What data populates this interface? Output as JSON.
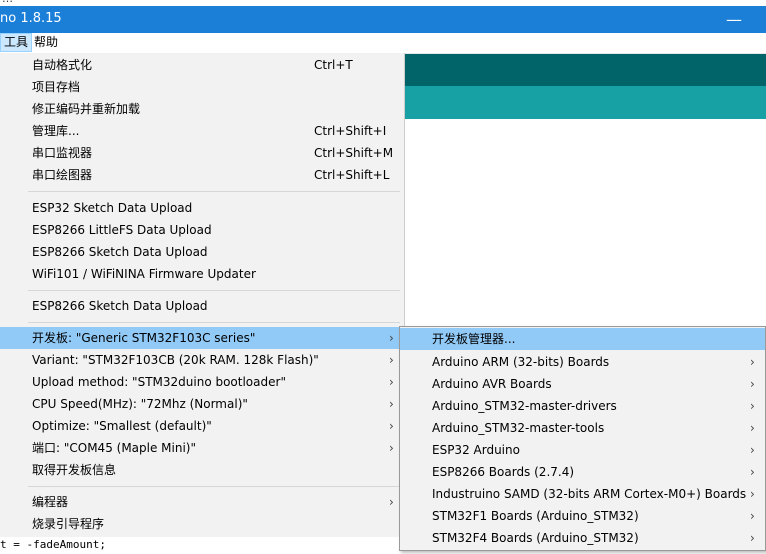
{
  "window": {
    "title": "no 1.8.15",
    "minimize_glyph": "—"
  },
  "top_strip_text": "…",
  "menubar": {
    "items": [
      {
        "label": "工具",
        "active": true
      },
      {
        "label": "帮助",
        "active": false
      }
    ]
  },
  "tools_menu": {
    "arrow_glyph": "›",
    "items": [
      {
        "label": "自动格式化",
        "shortcut": "Ctrl+T"
      },
      {
        "label": "项目存档",
        "shortcut": ""
      },
      {
        "label": "修正编码并重新加载",
        "shortcut": ""
      },
      {
        "label": "管理库...",
        "shortcut": "Ctrl+Shift+I"
      },
      {
        "label": "串口监视器",
        "shortcut": "Ctrl+Shift+M"
      },
      {
        "label": "串口绘图器",
        "shortcut": "Ctrl+Shift+L"
      },
      {
        "label": "ESP32 Sketch Data Upload",
        "shortcut": ""
      },
      {
        "label": "ESP8266 LittleFS Data Upload",
        "shortcut": ""
      },
      {
        "label": "ESP8266 Sketch Data Upload",
        "shortcut": ""
      },
      {
        "label": "WiFi101 / WiFiNINA Firmware Updater",
        "shortcut": ""
      },
      {
        "label": "ESP8266 Sketch Data Upload",
        "shortcut": ""
      },
      {
        "label": "开发板: \"Generic STM32F103C series\"",
        "shortcut": ""
      },
      {
        "label": "Variant: \"STM32F103CB (20k RAM. 128k Flash)\"",
        "shortcut": ""
      },
      {
        "label": "Upload method: \"STM32duino bootloader\"",
        "shortcut": ""
      },
      {
        "label": "CPU Speed(MHz): \"72Mhz (Normal)\"",
        "shortcut": ""
      },
      {
        "label": "Optimize: \"Smallest (default)\"",
        "shortcut": ""
      },
      {
        "label": "端口: \"COM45 (Maple Mini)\"",
        "shortcut": ""
      },
      {
        "label": "取得开发板信息",
        "shortcut": ""
      },
      {
        "label": "编程器",
        "shortcut": ""
      },
      {
        "label": "烧录引导程序",
        "shortcut": ""
      }
    ]
  },
  "board_submenu": {
    "items": [
      {
        "label": "开发板管理器..."
      },
      {
        "label": "Arduino ARM (32-bits) Boards"
      },
      {
        "label": "Arduino AVR Boards"
      },
      {
        "label": "Arduino_STM32-master-drivers"
      },
      {
        "label": "Arduino_STM32-master-tools"
      },
      {
        "label": "ESP32 Arduino"
      },
      {
        "label": "ESP8266 Boards (2.7.4)"
      },
      {
        "label": "Industruino SAMD (32-bits ARM Cortex-M0+) Boards"
      },
      {
        "label": "STM32F1 Boards (Arduino_STM32)"
      },
      {
        "label": "STM32F4 Boards (Arduino_STM32)"
      }
    ]
  },
  "editor": {
    "visible_code_line": "t = -fadeAmount;"
  },
  "colors": {
    "titlebar": "#1b7fd8",
    "toolbar_dark": "#006468",
    "tabbar_teal": "#17a1a5",
    "menu_bg": "#f2f2f2",
    "menu_highlight": "#91c9f7"
  }
}
